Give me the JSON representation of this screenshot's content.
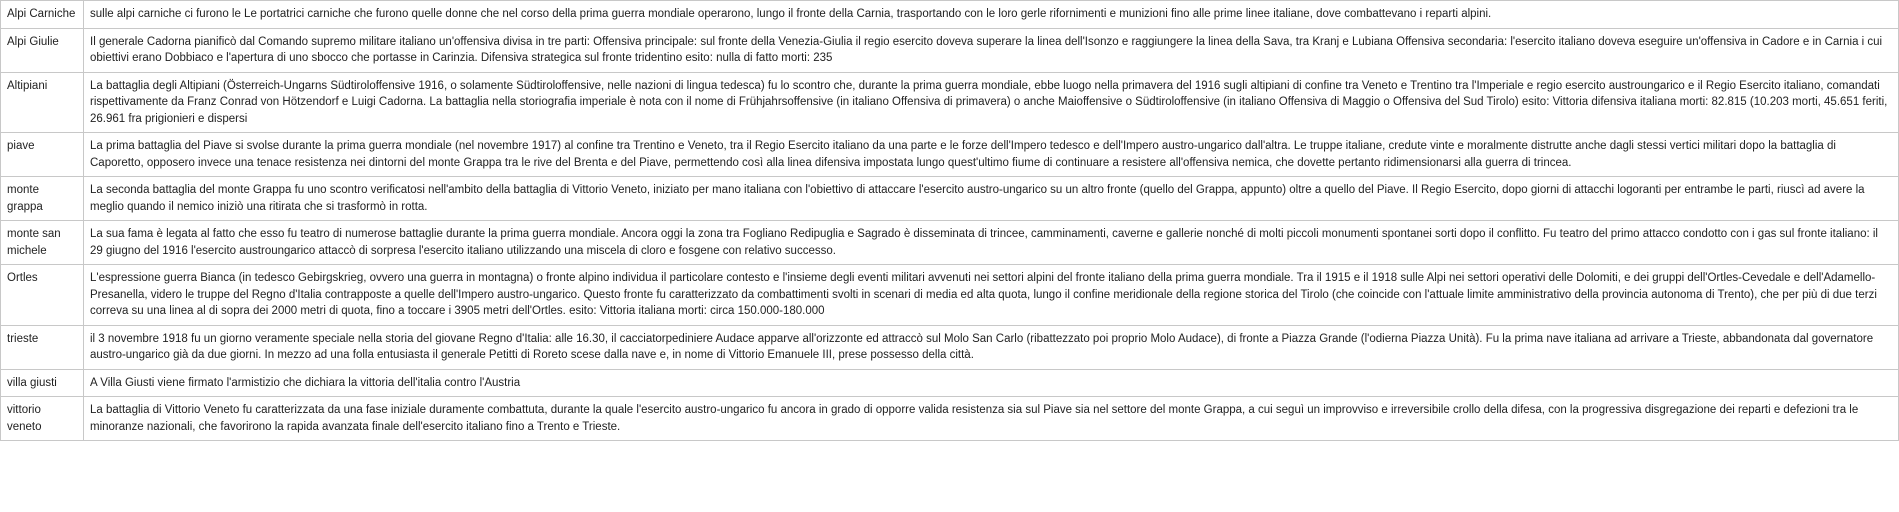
{
  "table": {
    "rows": [
      {
        "name": "Alpi Carniche",
        "description": "sulle alpi carniche ci furono le Le portatrici carniche che furono quelle donne che nel corso della prima guerra mondiale operarono, lungo il fronte della Carnia, trasportando con le loro gerle rifornimenti e munizioni fino alle prime linee italiane, dove combattevano i reparti alpini."
      },
      {
        "name": "Alpi Giulie",
        "description": "Il generale Cadorna pianificò dal Comando supremo militare italiano un'offensiva divisa in tre parti: Offensiva principale: sul fronte della Venezia-Giulia il regio esercito doveva superare la linea dell'Isonzo e raggiungere la linea della Sava, tra Kranj e Lubiana Offensiva secondaria: l'esercito italiano doveva eseguire un'offensiva in Cadore e in Carnia i cui obiettivi erano Dobbiaco e l'apertura di uno sbocco che portasse in Carinzia. Difensiva strategica sul fronte tridentino esito: nulla di fatto morti: 235"
      },
      {
        "name": "Altipiani",
        "description": "La battaglia degli Altipiani (Österreich-Ungarns Südtiroloffensive 1916, o solamente Südtiroloffensive, nelle nazioni di lingua tedesca) fu lo scontro che, durante la prima guerra mondiale, ebbe luogo nella primavera del 1916 sugli altipiani di confine tra Veneto e Trentino tra l'Imperiale e regio esercito austroungarico e il Regio Esercito italiano, comandati rispettivamente da Franz Conrad von Hötzendorf e Luigi Cadorna. La battaglia nella storiografia imperiale è nota con il nome di Frühjahrsoffensive (in italiano Offensiva di primavera) o anche Maioffensive o Südtiroloffensive (in italiano Offensiva di Maggio o Offensiva del Sud Tirolo) esito: Vittoria difensiva italiana morti: 82.815 (10.203 morti, 45.651 feriti, 26.961 fra prigionieri e dispersi"
      },
      {
        "name": "piave",
        "description": "La prima battaglia del Piave si svolse durante la prima guerra mondiale (nel novembre 1917) al confine tra Trentino e Veneto, tra il Regio Esercito italiano da una parte e le forze dell'Impero tedesco e dell'Impero austro-ungarico dall'altra. Le truppe italiane, credute vinte e moralmente distrutte anche dagli stessi vertici militari dopo la battaglia di Caporetto, opposero invece una tenace resistenza nei dintorni del monte Grappa tra le rive del Brenta e del Piave, permettendo così alla linea difensiva impostata lungo quest'ultimo fiume di continuare a resistere all'offensiva nemica, che dovette pertanto ridimensionarsi alla guerra di trincea."
      },
      {
        "name": "monte grappa",
        "description": "La seconda battaglia del monte Grappa fu uno scontro verificatosi nell'ambito della battaglia di Vittorio Veneto, iniziato per mano italiana con l'obiettivo di attaccare l'esercito austro-ungarico su un altro fronte (quello del Grappa, appunto) oltre a quello del Piave. Il Regio Esercito, dopo giorni di attacchi logoranti per entrambe le parti, riuscì ad avere la meglio quando il nemico iniziò una ritirata che si trasformò in rotta."
      },
      {
        "name": "monte san michele",
        "description": "La sua fama è legata al fatto che esso fu teatro di numerose battaglie durante la prima guerra mondiale. Ancora oggi la zona tra Fogliano Redipuglia e Sagrado è disseminata di trincee, camminamenti, caverne e gallerie nonché di molti piccoli monumenti spontanei sorti dopo il conflitto. Fu teatro del primo attacco condotto con i gas sul fronte italiano: il 29 giugno del 1916 l'esercito austroungarico attaccò di sorpresa l'esercito italiano utilizzando una miscela di cloro e fosgene con relativo successo."
      },
      {
        "name": "Ortles",
        "description": "L'espressione guerra Bianca (in tedesco Gebirgskrieg, ovvero una guerra in montagna) o fronte alpino individua il particolare contesto e l'insieme degli eventi militari avvenuti nei settori alpini del fronte italiano della prima guerra mondiale. Tra il 1915 e il 1918 sulle Alpi nei settori operativi delle Dolomiti, e dei gruppi dell'Ortles-Cevedale e dell'Adamello-Presanella, videro le truppe del Regno d'Italia contrapposte a quelle dell'Impero austro-ungarico. Questo fronte fu caratterizzato da combattimenti svolti in scenari di media ed alta quota, lungo il confine meridionale della regione storica del Tirolo (che coincide con l'attuale limite amministrativo della provincia autonoma di Trento), che per più di due terzi correva su una linea al di sopra dei 2000 metri di quota, fino a toccare i 3905 metri dell'Ortles. esito: Vittoria italiana morti: circa 150.000-180.000"
      },
      {
        "name": "trieste",
        "description": "il 3 novembre 1918 fu un giorno veramente speciale nella storia del giovane Regno d'Italia: alle 16.30, il cacciatorpediniere Audace apparve all'orizzonte ed attraccò sul Molo San Carlo (ribattezzato poi proprio Molo Audace), di fronte a Piazza Grande (l'odierna Piazza Unità). Fu la prima nave italiana ad arrivare a Trieste, abbandonata dal governatore austro-ungarico già da due giorni. In mezzo ad una folla entusiasta il generale Petitti di Roreto scese dalla nave e, in nome di Vittorio Emanuele III, prese possesso della città."
      },
      {
        "name": "villa giusti",
        "description": "A Villa Giusti viene firmato l'armistizio che dichiara la vittoria dell'italia contro l'Austria"
      },
      {
        "name": "vittorio veneto",
        "description": "La battaglia di Vittorio Veneto fu caratterizzata da una fase iniziale duramente combattuta, durante la quale l'esercito austro-ungarico fu ancora in grado di opporre valida resistenza sia sul Piave sia nel settore del monte Grappa, a cui seguì un improvviso e irreversibile crollo della difesa, con la progressiva disgregazione dei reparti e defezioni tra le minoranze nazionali, che favorirono la rapida avanzata finale dell'esercito italiano fino a Trento e Trieste."
      }
    ]
  }
}
